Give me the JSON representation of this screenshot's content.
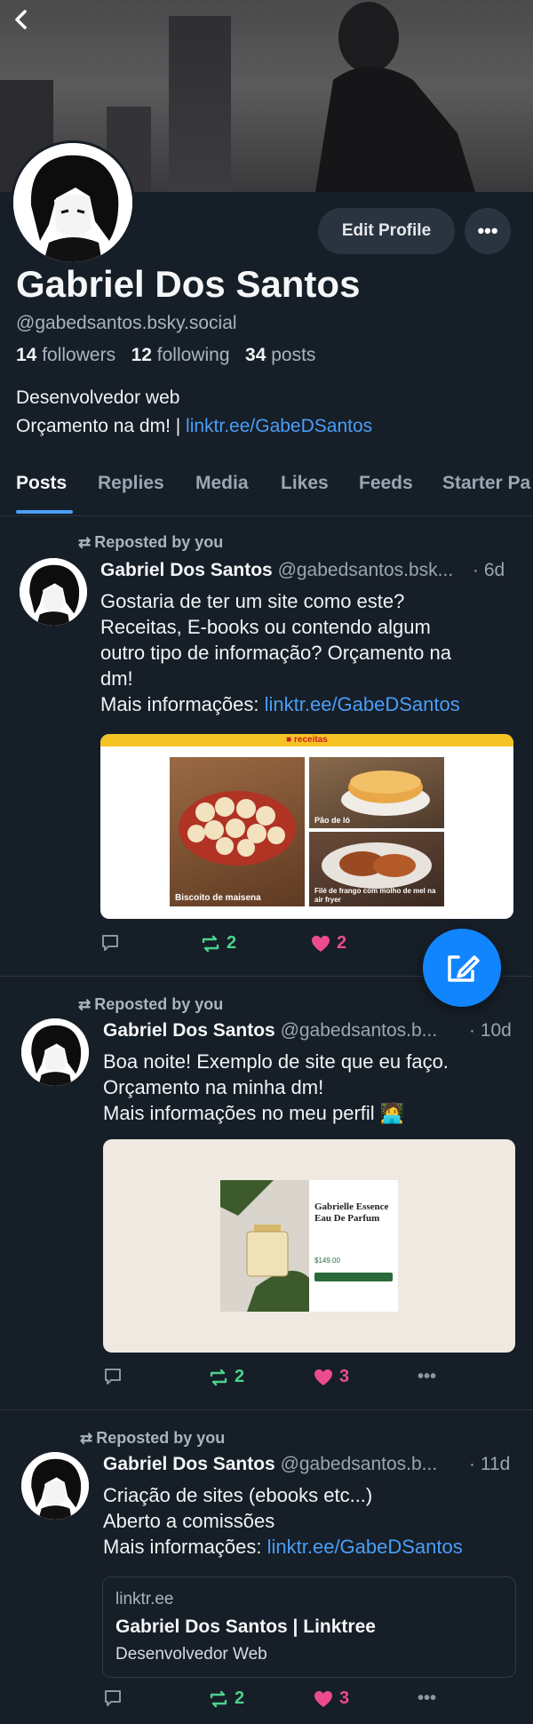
{
  "header": {
    "back_icon": "chevron-left-icon"
  },
  "profile": {
    "name": "Gabriel Dos Santos",
    "handle": "@gabedsantos.bsky.social",
    "followers_count": "14",
    "followers_label": "followers",
    "following_count": "12",
    "following_label": "following",
    "posts_count": "34",
    "posts_label": "posts",
    "bio_line1": "Desenvolvedor web",
    "bio_line2_prefix": "Orçamento na dm! | ",
    "bio_link": "linktr.ee/GabeDSantos",
    "edit_button": "Edit Profile",
    "more_button": "•••"
  },
  "tabs": [
    "Posts",
    "Replies",
    "Media",
    "Likes",
    "Feeds",
    "Starter Pa"
  ],
  "posts": [
    {
      "repost_label": "Reposted by you",
      "author_name": "Gabriel Dos Santos",
      "author_handle": "@gabedsantos.bsk...",
      "time": "· 6d",
      "text_lines": [
        "Gostaria de ter um site como este?",
        "Receitas, E-books ou contendo algum",
        "outro tipo de informação? Orçamento na",
        "dm!"
      ],
      "more_prefix": "Mais informações: ",
      "more_link": "linktr.ee/GabeDSantos",
      "embed": {
        "site_title": "receitas",
        "card1": "Biscoito de maisena",
        "card2": "Pão de ló",
        "card3": "Filé de frango com molho de mel na air fryer"
      },
      "reposts": "2",
      "likes": "2"
    },
    {
      "repost_label": "Reposted by you",
      "author_name": "Gabriel Dos Santos",
      "author_handle": "@gabedsantos.b...",
      "time": "· 10d",
      "text_lines": [
        "Boa noite! Exemplo de site que eu faço.",
        "Orçamento na minha dm!",
        "Mais informações no meu perfil 🧑‍💻"
      ],
      "embed": {
        "product_name": "Gabrielle Essence Eau De Parfum",
        "price": "$149.00"
      },
      "reposts": "2",
      "likes": "3",
      "more": "•••"
    },
    {
      "repost_label": "Reposted by you",
      "author_name": "Gabriel Dos Santos",
      "author_handle": "@gabedsantos.b...",
      "time": "· 11d",
      "text_lines": [
        "Criação de sites (ebooks etc...)",
        "Aberto a comissões"
      ],
      "more_prefix": "Mais informações: ",
      "more_link": "linktr.ee/GabeDSantos",
      "link_card": {
        "domain": "linktr.ee",
        "title": "Gabriel Dos Santos | Linktree",
        "description": "Desenvolvedor Web"
      },
      "reposts": "2",
      "likes": "3",
      "more": "•••"
    }
  ],
  "fab": {
    "icon": "compose-icon"
  },
  "colors": {
    "accent": "#4a9ef8",
    "background": "#161e27",
    "repost_green": "#4cd28e",
    "like_pink": "#ec4c8c",
    "fab_blue": "#1185fe"
  }
}
